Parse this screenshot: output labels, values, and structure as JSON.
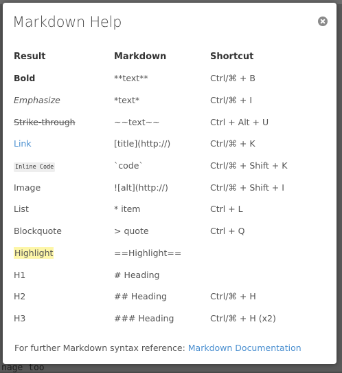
{
  "background": {
    "editor_text": "nage too"
  },
  "modal": {
    "title": "Markdown Help",
    "close_icon": "close-circle-icon",
    "columns": {
      "result": "Result",
      "markdown": "Markdown",
      "shortcut": "Shortcut"
    },
    "rows": [
      {
        "result": "Bold",
        "markdown": "**text**",
        "shortcut": "Ctrl/⌘ + B"
      },
      {
        "result": "Emphasize",
        "markdown": "*text*",
        "shortcut": "Ctrl/⌘ + I"
      },
      {
        "result": "Strike-through",
        "markdown": "~~text~~",
        "shortcut": "Ctrl + Alt + U"
      },
      {
        "result": "Link",
        "markdown": "[title](http://)",
        "shortcut": "Ctrl/⌘ + K"
      },
      {
        "result": "Inline Code",
        "markdown": "`code`",
        "shortcut": "Ctrl/⌘ + Shift + K"
      },
      {
        "result": "Image",
        "markdown": "![alt](http://)",
        "shortcut": "Ctrl/⌘ + Shift + I"
      },
      {
        "result": "List",
        "markdown": "* item",
        "shortcut": "Ctrl + L"
      },
      {
        "result": "Blockquote",
        "markdown": "> quote",
        "shortcut": "Ctrl + Q"
      },
      {
        "result": "Highlight",
        "markdown": "==Highlight==",
        "shortcut": ""
      },
      {
        "result": "H1",
        "markdown": "# Heading",
        "shortcut": ""
      },
      {
        "result": "H2",
        "markdown": "## Heading",
        "shortcut": "Ctrl/⌘ + H"
      },
      {
        "result": "H3",
        "markdown": "### Heading",
        "shortcut": "Ctrl/⌘ + H (x2)"
      }
    ],
    "footer": {
      "text": "For further Markdown syntax reference: ",
      "link_label": "Markdown Documentation"
    }
  },
  "colors": {
    "link": "#4a8fd0",
    "highlight": "#fdf6a8"
  }
}
